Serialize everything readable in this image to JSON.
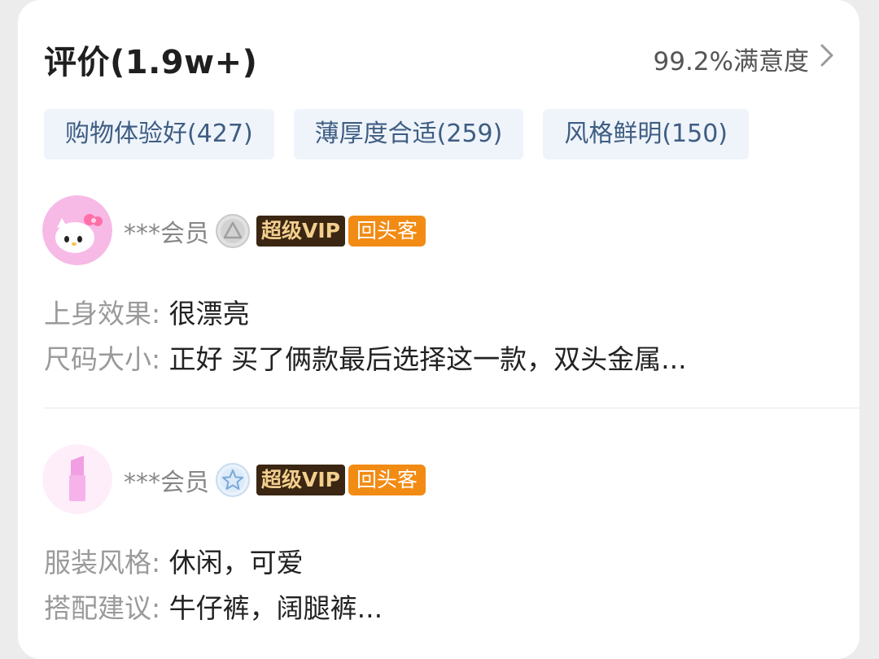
{
  "header": {
    "title": "评价(1.9w+)",
    "satisfaction": "99.2%满意度",
    "chevron_icon": "chevron-right-icon"
  },
  "tags": [
    {
      "label": "购物体验好(427)"
    },
    {
      "label": "薄厚度合适(259)"
    },
    {
      "label": "风格鲜明(150)"
    }
  ],
  "reviews": [
    {
      "avatar_icon": "hello-kitty-avatar",
      "username": "***会员",
      "level_icon": "triangle-level-icon",
      "vip_badge": "超级VIP",
      "return_badge": "回头客",
      "lines": [
        {
          "key": "上身效果:",
          "value": " 很漂亮"
        },
        {
          "key": "尺码大小:",
          "value": " 正好 买了俩款最后选择这一款，双头金属..."
        }
      ]
    },
    {
      "avatar_icon": "lipstick-avatar",
      "username": "***会员",
      "level_icon": "star-level-icon",
      "vip_badge": "超级VIP",
      "return_badge": "回头客",
      "lines": [
        {
          "key": "服装风格:",
          "value": " 休闲，可爱"
        },
        {
          "key": "搭配建议:",
          "value": " 牛仔裤，阔腿裤..."
        }
      ]
    }
  ],
  "colors": {
    "tag_bg": "#eff4fb",
    "tag_text": "#3e5d82",
    "vip_bg": "#3a2612",
    "vip_text": "#f2cf8e",
    "return_bg": "#f28b14"
  }
}
